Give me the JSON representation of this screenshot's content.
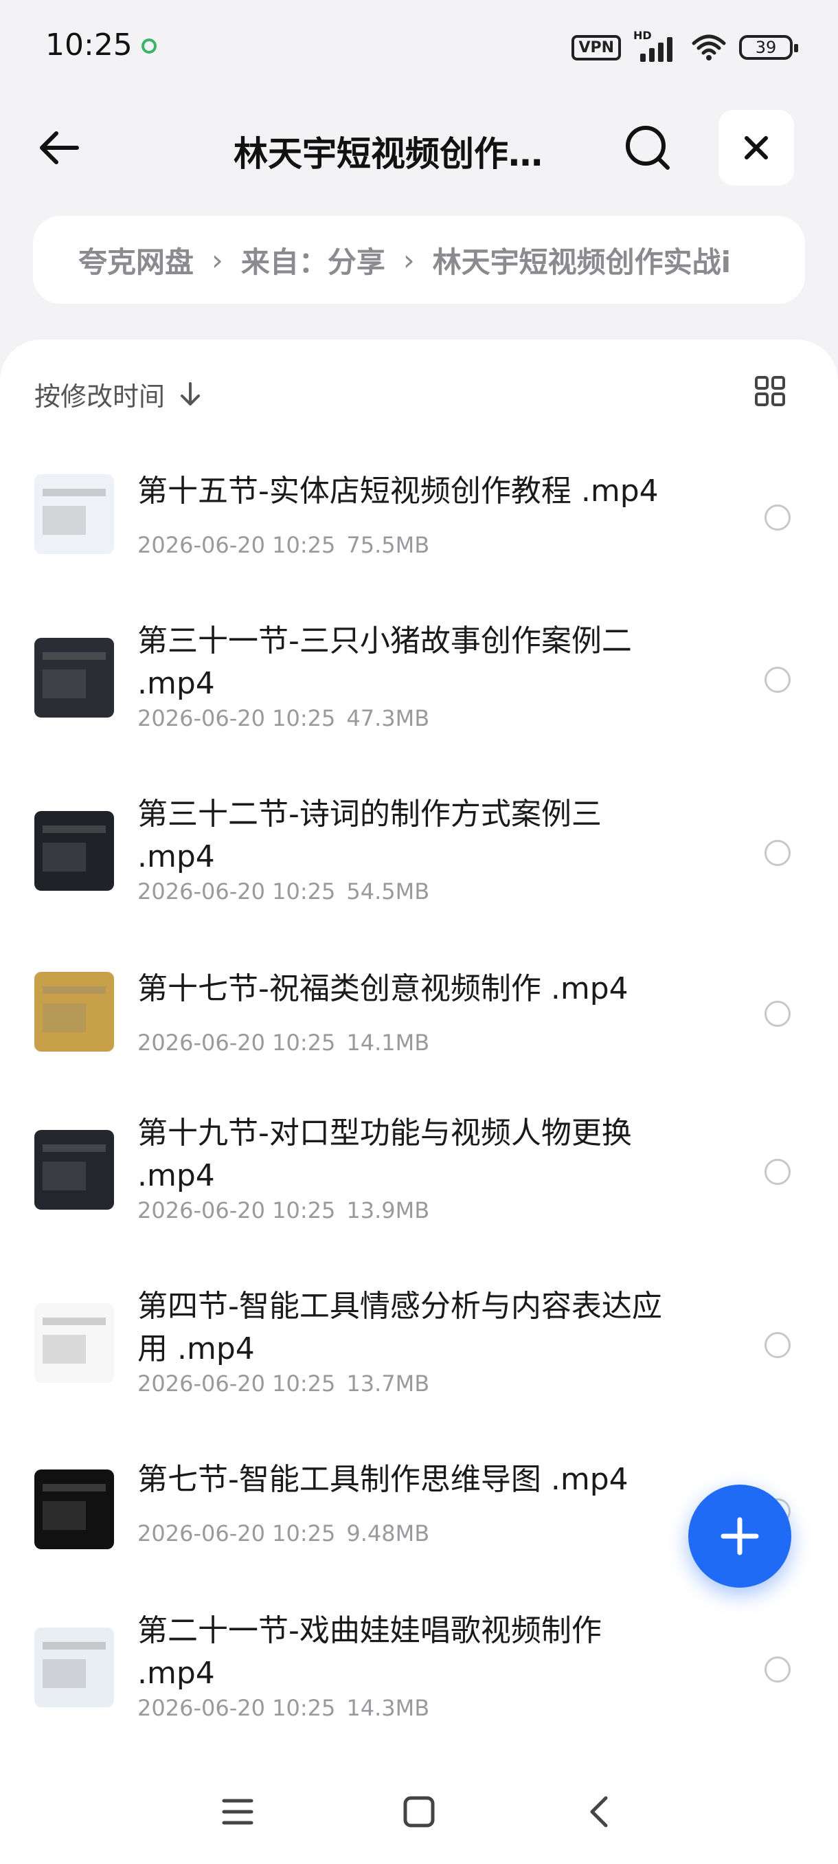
{
  "status_bar": {
    "time": "10:25",
    "vpn_label": "VPN",
    "network_label": "HD",
    "battery": "39"
  },
  "header": {
    "title": "林天宇短视频创作…"
  },
  "breadcrumb": {
    "items": [
      "夸克网盘",
      "来自：分享",
      "林天宇短视频创作实战i"
    ]
  },
  "sort": {
    "label": "按修改时间"
  },
  "files": [
    {
      "name": "第十五节-实体店短视频创作教程 .mp4",
      "date": "2026-06-20 10:25",
      "size": "75.5MB",
      "thumb_color": "#eef1f6"
    },
    {
      "name": "第三十一节-三只小猪故事创作案例二 .mp4",
      "date": "2026-06-20 10:25",
      "size": "47.3MB",
      "thumb_color": "#2a2d33"
    },
    {
      "name": "第三十二节-诗词的制作方式案例三 .mp4",
      "date": "2026-06-20 10:25",
      "size": "54.5MB",
      "thumb_color": "#1f2328"
    },
    {
      "name": "第十七节-祝福类创意视频制作 .mp4",
      "date": "2026-06-20 10:25",
      "size": "14.1MB",
      "thumb_color": "#c9a04a"
    },
    {
      "name": "第十九节-对口型功能与视频人物更换 .mp4",
      "date": "2026-06-20 10:25",
      "size": "13.9MB",
      "thumb_color": "#23272d"
    },
    {
      "name": "第四节-智能工具情感分析与内容表达应用 .mp4",
      "date": "2026-06-20 10:25",
      "size": "13.7MB",
      "thumb_color": "#f7f7f7"
    },
    {
      "name": "第七节-智能工具制作思维导图 .mp4",
      "date": "2026-06-20 10:25",
      "size": "9.48MB",
      "thumb_color": "#111111"
    },
    {
      "name": "第二十一节-戏曲娃娃唱歌视频制作 .mp4",
      "date": "2026-06-20 10:25",
      "size": "14.3MB",
      "thumb_color": "#e9eef3"
    }
  ],
  "colors": {
    "accent": "#1f6bf5",
    "background": "#f3f3f5"
  }
}
